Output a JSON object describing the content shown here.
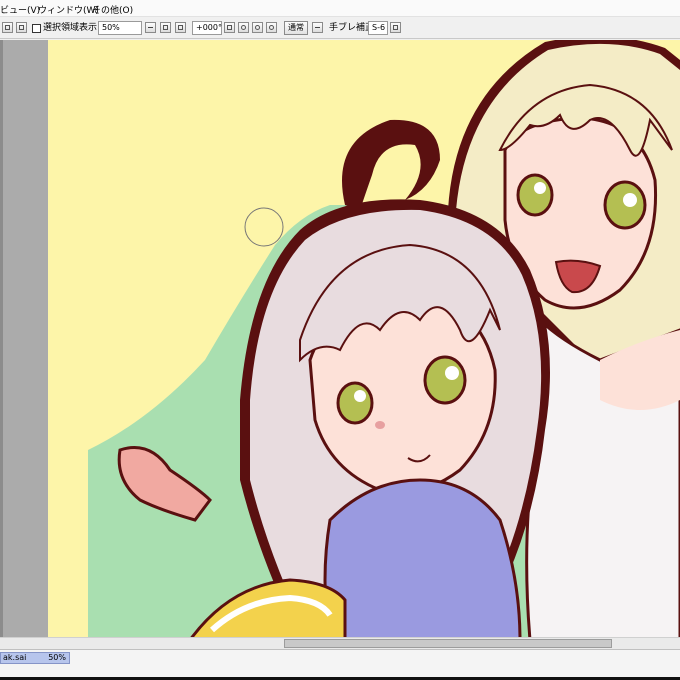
{
  "menu": {
    "items": [
      {
        "label": "ビュー(V)"
      },
      {
        "label": "ウィンドウ(W)"
      },
      {
        "label": "その他(O)"
      }
    ]
  },
  "toolbar": {
    "selection_view_label": "選択領域表示",
    "zoom_value": "50%",
    "rotation_value": "+000°",
    "blend_mode_value": "通常",
    "stabilizer_label": "手ブレ補正",
    "stabilizer_value": "S-6"
  },
  "document_tab": {
    "filename": "ak.sai",
    "zoom": "50%"
  },
  "colors": {
    "background_yellow": "#fdf5a9",
    "background_green": "#a9dfb0",
    "outline": "#5a1010",
    "hair_silver": "#e8dcdf",
    "hair_blonde": "#f4ecc6",
    "skin": "#fde1d8",
    "eye": "#b4bf52",
    "sweater": "#9a9ae0",
    "tab_highlight": "#b7c5ec"
  },
  "icons": [
    "grid-icon",
    "layers-icon",
    "zoom-out-icon",
    "zoom-in-icon",
    "zoom-reset-icon",
    "rotate-reset-icon",
    "rotate-left-icon",
    "rotate-right-icon",
    "rotate-ccw-icon",
    "flip-icon",
    "stabilizer-icon"
  ]
}
